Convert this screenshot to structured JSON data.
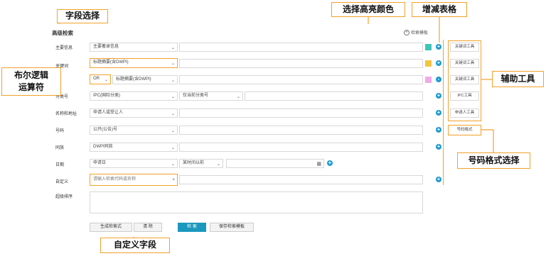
{
  "panel": {
    "title": "高级检索",
    "template_link": "检索模板"
  },
  "rows": [
    {
      "label": "主要信息",
      "select": "主要著录信息",
      "op": "+"
    },
    {
      "label": "关键词",
      "select": "标题摘要(含DWPI)",
      "op": "+"
    },
    {
      "label": "",
      "bool": "OR",
      "select": "标题摘要(含DWPI)",
      "op": "-"
    },
    {
      "label": "分类号",
      "select": "IPC(国际分类)",
      "select2": "仅当前分类号",
      "op": "+"
    },
    {
      "label": "名称和地址",
      "select": "申请人或受让人",
      "op": "+"
    },
    {
      "label": "号码",
      "select": "公开(公告)号",
      "op": "+"
    },
    {
      "label": "同族",
      "select": "DWPI同族",
      "op": "+"
    },
    {
      "label": "日期",
      "select": "申请日",
      "select2": "某时间以前",
      "op": "+"
    },
    {
      "label": "自定义",
      "custom_placeholder": "请输入检索代码或名称",
      "clear": "×",
      "op": "+"
    },
    {
      "label": "超级排序"
    }
  ],
  "tools": [
    "关键词工具",
    "关键词工具",
    "关键词工具",
    "IPC工具",
    "申请人工具",
    "号码格式"
  ],
  "buttons": {
    "generate": "生成检索式",
    "clear": "清 除",
    "search": "检 索",
    "save": "保存检索模板"
  },
  "callouts": {
    "field_select": "字段选择",
    "highlight_color": "选择高亮颜色",
    "add_remove_rows": "增减表格",
    "bool_op_line1": "布尔逻辑",
    "bool_op_line2": "运算符",
    "helper_tools": "辅助工具",
    "number_format": "号码格式选择",
    "custom_field": "自定义字段"
  },
  "colors": {
    "accent": "#1a9ad2",
    "callout_border": "#f2a12b",
    "hl_teal": "#3ec6b9",
    "hl_yellow": "#f5c542",
    "hl_pink": "#f1a9e8"
  }
}
